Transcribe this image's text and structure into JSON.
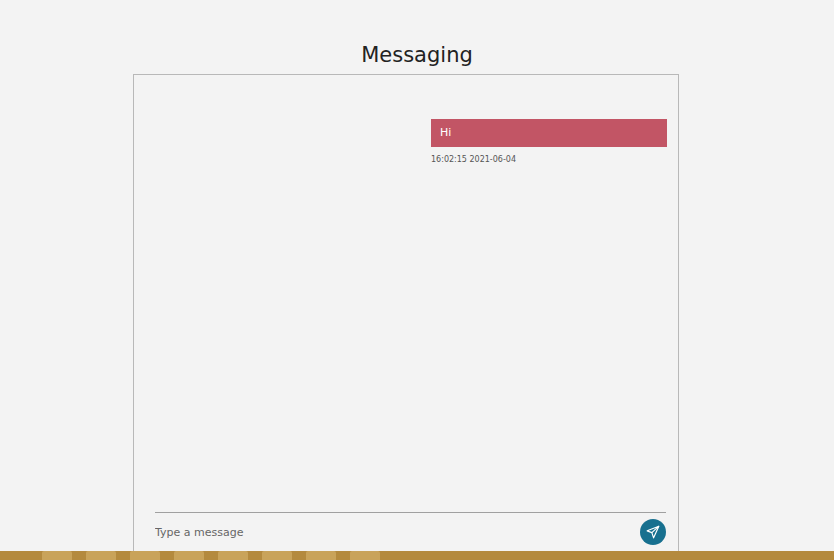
{
  "page": {
    "title": "Messaging"
  },
  "messages": [
    {
      "text": "Hi",
      "time": "16:02:15 2021-06-04",
      "outgoing": true
    }
  ],
  "composer": {
    "placeholder": "Type a message"
  }
}
